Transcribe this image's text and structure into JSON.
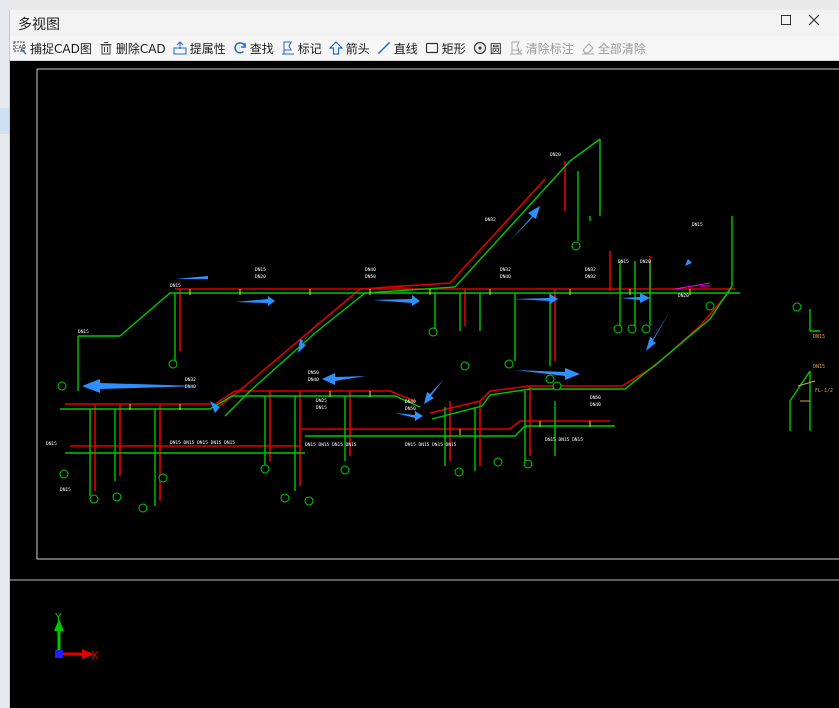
{
  "window": {
    "title": "多视图"
  },
  "toolbar": {
    "items": [
      {
        "label": "捕捉CAD图",
        "icon": "capture-cad-icon",
        "enabled": true
      },
      {
        "label": "删除CAD",
        "icon": "trash-icon",
        "enabled": true
      },
      {
        "label": "提属性",
        "icon": "extract-attribute-icon",
        "enabled": true
      },
      {
        "label": "查找",
        "icon": "search-refresh-icon",
        "enabled": true
      },
      {
        "label": "标记",
        "icon": "mark-icon",
        "enabled": true
      },
      {
        "label": "箭头",
        "icon": "arrow-up-icon",
        "enabled": true
      },
      {
        "label": "直线",
        "icon": "line-icon",
        "enabled": true
      },
      {
        "label": "矩形",
        "icon": "rectangle-icon",
        "enabled": true
      },
      {
        "label": "圆",
        "icon": "circle-icon",
        "enabled": true
      },
      {
        "label": "清除标注",
        "icon": "clear-mark-icon",
        "enabled": false
      },
      {
        "label": "全部清除",
        "icon": "eraser-icon",
        "enabled": false
      }
    ]
  },
  "canvas": {
    "axis_x_label": "X",
    "axis_y_label": "Y",
    "colors": {
      "pipe_green": "#00c800",
      "pipe_red": "#e00000",
      "arrow_blue": "#2e8fff",
      "label_white": "#ffffff",
      "accent_orange": "#d9a441",
      "accent_magenta": "#ff00ff"
    }
  }
}
